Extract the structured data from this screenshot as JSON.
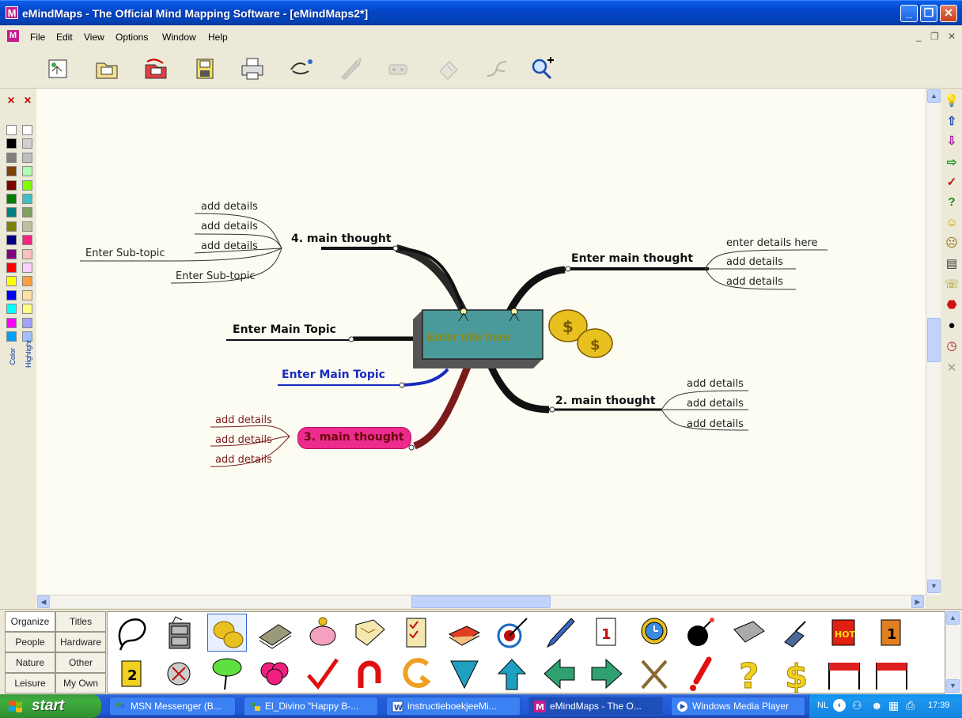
{
  "window": {
    "title": "eMindMaps - The Official  Mind Mapping Software - [eMindMaps2*]",
    "app_icon": "M"
  },
  "menu": {
    "icon": "M",
    "items": [
      "File",
      "Edit",
      "View",
      "Options",
      "Window",
      "Help"
    ]
  },
  "toolbar": {
    "buttons": [
      "new-map-icon",
      "open-map-icon",
      "open-recent-icon",
      "save-icon",
      "print-icon",
      "link-icon",
      "launch-icon",
      "record-icon",
      "export-icon",
      "branch-icon",
      "zoom-in-icon"
    ]
  },
  "map": {
    "central_title": "Enter title here",
    "topics": {
      "main4": "4. main thought",
      "main4_details": [
        "add details",
        "add details",
        "add details"
      ],
      "main4_subtopics": [
        "Enter Sub-topic",
        "Enter Sub-topic"
      ],
      "main1": "Enter main thought",
      "main1_details": [
        "enter details here",
        "add details",
        "add details"
      ],
      "main_topic_black": "Enter Main Topic",
      "main_topic_blue": "Enter Main Topic",
      "main2": "2. main thought",
      "main2_details": [
        "add details",
        "add details",
        "add details"
      ],
      "main3": "3. main thought",
      "main3_details": [
        "add details",
        "add details",
        "add details"
      ]
    }
  },
  "palette": {
    "color_tab": "Color",
    "highlight_tab": "Highlight",
    "color_swatches": [
      "#ffffff",
      "#000000",
      "#808080",
      "#804000",
      "#800000",
      "#008000",
      "#008080",
      "#808000",
      "#000080",
      "#800080",
      "#ff0000",
      "#ffff00",
      "#0000ff",
      "#00ffff",
      "#ff00ff",
      "#00a0ff"
    ],
    "highlight_swatches": [
      "#ffffff",
      "#d0d0d0",
      "#c0c0c0",
      "#b0ffb0",
      "#80ff00",
      "#40c0c0",
      "#80a060",
      "#c0c0a0",
      "#ff2080",
      "#ffc0c0",
      "#ffd0ff",
      "#ffa040",
      "#ffe0a0",
      "#ffff80",
      "#a0a0ff",
      "#a0c0ff"
    ]
  },
  "right_icons": [
    "lightbulb-icon",
    "up-arrow-icon",
    "down-arrow-icon",
    "right-arrow-icon",
    "checkmark-icon",
    "question-icon",
    "smiley-icon",
    "neutral-face-icon",
    "note-icon",
    "phone-icon",
    "stop-icon",
    "bomb-icon",
    "clock-icon",
    "delete-x-icon"
  ],
  "clipart": {
    "categories": [
      [
        "Organize",
        "Titles"
      ],
      [
        "People",
        "Hardware"
      ],
      [
        "Nature",
        "Other"
      ],
      [
        "Leisure",
        "My Own"
      ]
    ],
    "active_category": "Organize"
  },
  "taskbar": {
    "start": "start",
    "tasks": [
      {
        "label": "MSN Messenger (B...",
        "icon": "msn-icon"
      },
      {
        "label": "El_Divino \"Happy B-...",
        "icon": "chat-icon"
      },
      {
        "label": "instructieboekjeeMi...",
        "icon": "word-icon"
      },
      {
        "label": "eMindMaps - The O...",
        "icon": "emindmaps-icon"
      },
      {
        "label": "Windows Media Player",
        "icon": "media-player-icon"
      }
    ],
    "tray_lang": "NL",
    "clock": "17:39"
  },
  "colors": {
    "accent_pink": "#ec2b8c",
    "central_fill": "#4a9a9a",
    "central_text": "#8a8a1a",
    "blue_topic": "#1a2ac0",
    "red_branch": "#7a1a1a"
  }
}
